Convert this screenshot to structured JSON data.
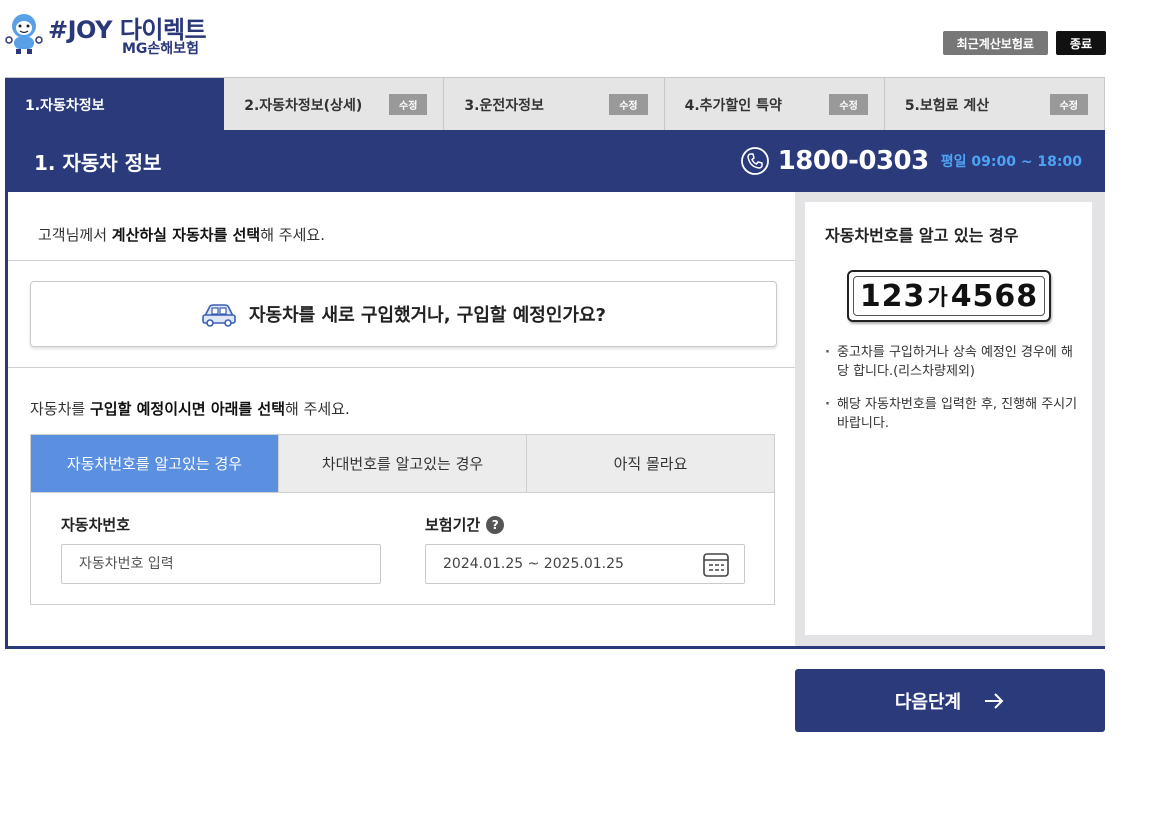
{
  "header": {
    "logo_title": "#JOY 다이렉트",
    "logo_sub": "MG손해보험",
    "recent_label": "최근계산보험료",
    "close_label": "종료"
  },
  "tabs": [
    {
      "label": "1.자동차정보",
      "edit": ""
    },
    {
      "label": "2.자동차정보(상세)",
      "edit": "수정"
    },
    {
      "label": "3.운전자정보",
      "edit": "수정"
    },
    {
      "label": "4.추가할인 특약",
      "edit": "수정"
    },
    {
      "label": "5.보험료 계산",
      "edit": "수정"
    }
  ],
  "section": {
    "title": "1. 자동차 정보",
    "phone": "1800-0303",
    "hours": "평일 09:00 ~ 18:00"
  },
  "left": {
    "instr1_a": "고객님께서 ",
    "instr1_b": "계산하실 자동차를 선택",
    "instr1_c": "해 주세요.",
    "newcar_label": "자동차를 새로 구입했거나, 구입할 예정인가요?",
    "instr2_a": "자동차를 ",
    "instr2_b": "구입할 예정이시면 아래를 선택",
    "instr2_c": "해 주세요.",
    "subtabs": [
      "자동차번호를 알고있는 경우",
      "차대번호를 알고있는 경우",
      "아직 몰라요"
    ],
    "car_label": "자동차번호",
    "car_placeholder": "자동차번호 입력",
    "period_label": "보험기간",
    "period_value": "2024.01.25 ~ 2025.01.25"
  },
  "right": {
    "title": "자동차번호를 알고 있는 경우",
    "plate_a": "123",
    "plate_kor": "가",
    "plate_b": "4568",
    "notes": [
      "중고차를 구입하거나 상속 예정인 경우에 해당 합니다.(리스차량제외)",
      "해당 자동차번호를 입력한 후, 진행해 주시기 바랍니다."
    ]
  },
  "next_label": "다음단계",
  "colors": {
    "navy": "#2b3a7b",
    "tab_active_blue": "#5b8fe0",
    "hours_blue": "#4ea3f4"
  }
}
